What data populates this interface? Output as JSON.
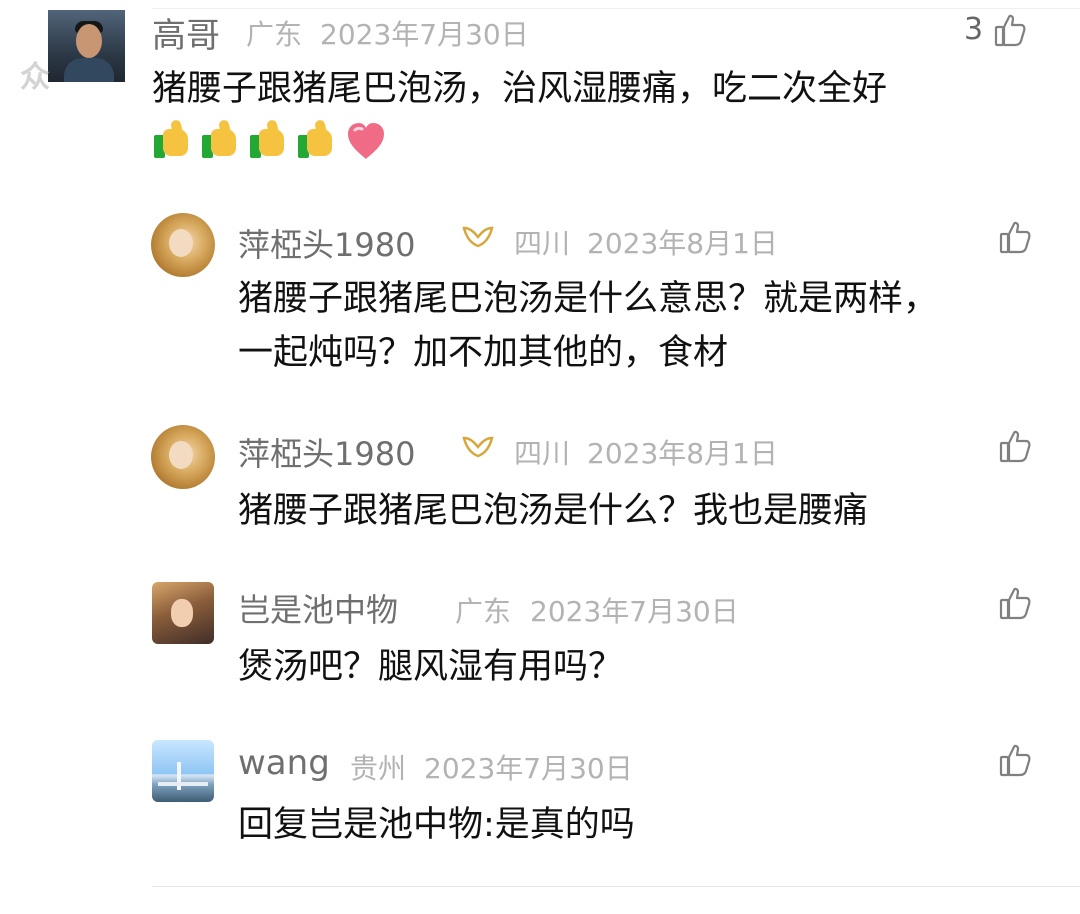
{
  "watermark": "众",
  "comments": [
    {
      "author": "高哥",
      "location": "广东",
      "date": "2023年7月30日",
      "likes": "3",
      "content": "猪腰子跟猪尾巴泡汤，治风湿腰痛，吃二次全好",
      "emojis": [
        "thumbs-up",
        "thumbs-up",
        "thumbs-up",
        "thumbs-up",
        "heart"
      ]
    }
  ],
  "replies": [
    {
      "author": "萍椏头1980",
      "badge": "vip-icon",
      "location": "四川",
      "date": "2023年8月1日",
      "content_lines": [
        "猪腰子跟猪尾巴泡汤是什么意思？就是两样，",
        "一起炖吗？加不加其他的，食材"
      ]
    },
    {
      "author": "萍椏头1980",
      "badge": "vip-icon",
      "location": "四川",
      "date": "2023年8月1日",
      "content_lines": [
        "猪腰子跟猪尾巴泡汤是什么？我也是腰痛"
      ]
    },
    {
      "author": "岂是池中物",
      "location": "广东",
      "date": "2023年7月30日",
      "content_lines": [
        "煲汤吧？腿风湿有用吗？"
      ]
    },
    {
      "author": "wang",
      "location": "贵州",
      "date": "2023年7月30日",
      "content_lines": [
        "回复岂是池中物:是真的吗"
      ]
    }
  ],
  "colors": {
    "author": "#6f6f6f",
    "meta": "#b3b3b3",
    "content": "#111111",
    "badge": "#d9a63a",
    "divider": "#e7e7e7"
  }
}
